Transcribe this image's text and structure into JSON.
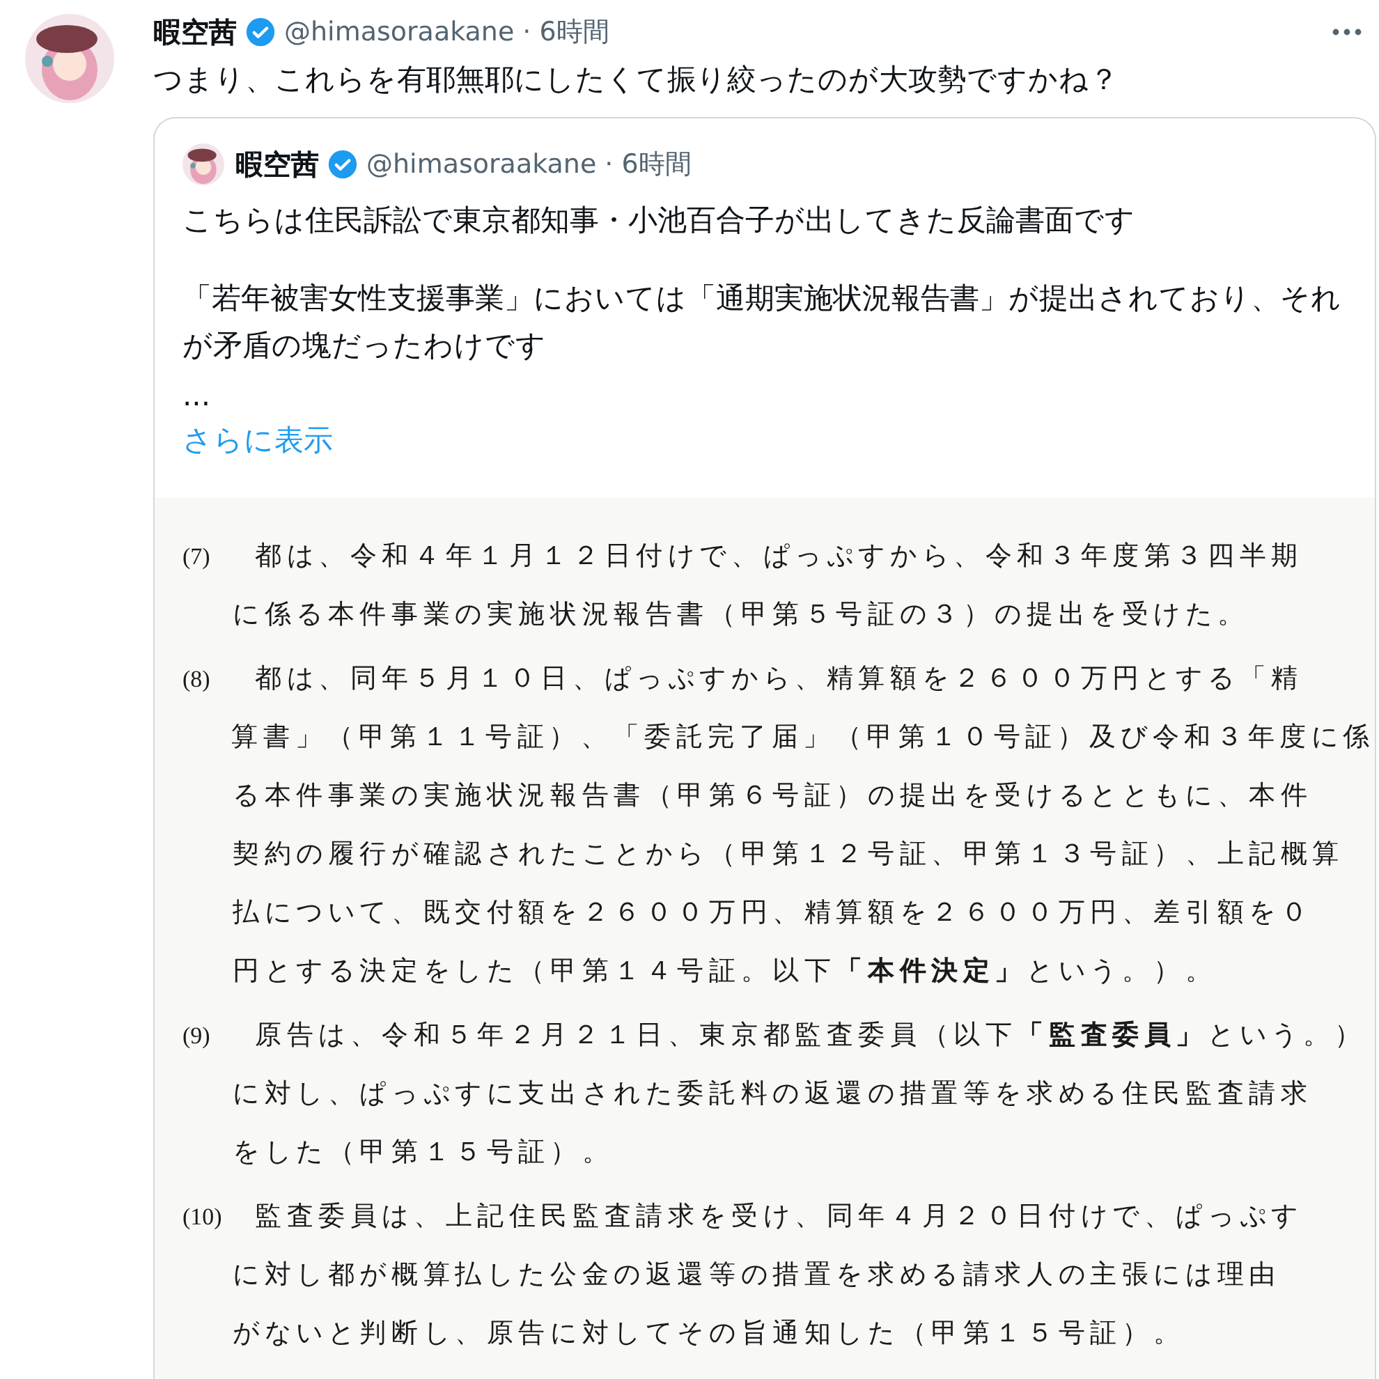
{
  "tweet": {
    "display_name": "暇空茜",
    "handle": "@himasoraakane",
    "separator": "·",
    "time": "6時間",
    "verified": true,
    "text": "つまり、これらを有耶無耶にしたくて振り絞ったのが大攻勢ですかね？",
    "quote": {
      "display_name": "暇空茜",
      "handle": "@himasoraakane",
      "separator": "·",
      "time": "6時間",
      "verified": true,
      "paragraphs": [
        "こちらは住民訴訟で東京都知事・小池百合子が出してきた反論書面です",
        "「若年被害女性支援事業」においては「通期実施状況報告書」が提出されており、それが矛盾の塊だったわけです",
        "..."
      ],
      "show_more": "さらに表示",
      "document": {
        "items": [
          {
            "number": "(7)",
            "lines": [
              "都は、令和４年１月１２日付けで、ぱっぷすから、令和３年度第３四半期",
              "に係る本件事業の実施状況報告書（甲第５号証の３）の提出を受けた。"
            ]
          },
          {
            "number": "(8)",
            "lines": [
              "都は、同年５月１０日、ぱっぷすから、精算額を２６００万円とする「精",
              "算書」（甲第１１号証）、「委託完了届」（甲第１０号証）及び令和３年度に係",
              "る本件事業の実施状況報告書（甲第６号証）の提出を受けるとともに、本件",
              "契約の履行が確認されたことから（甲第１２号証、甲第１３号証）、上記概算",
              "払について、既交付額を２６００万円、精算額を２６００万円、差引額を０",
              "円とする決定をした（甲第１４号証。以下**「本件決定」**という。）。"
            ]
          },
          {
            "number": "(9)",
            "lines": [
              "原告は、令和５年２月２１日、東京都監査委員（以下**「監査委員」**という。）",
              "に対し、ぱっぷすに支出された委託料の返還の措置等を求める住民監査請求",
              "をした（甲第１５号証）。"
            ]
          },
          {
            "number": "(10)",
            "lines": [
              "監査委員は、上記住民監査請求を受け、同年４月２０日付けで、ぱっぷす",
              "に対し都が概算払した公金の返還等の措置を求める請求人の主張には理由",
              "がないと判断し、原告に対してその旨通知した（甲第１５号証）。"
            ]
          }
        ]
      }
    }
  }
}
